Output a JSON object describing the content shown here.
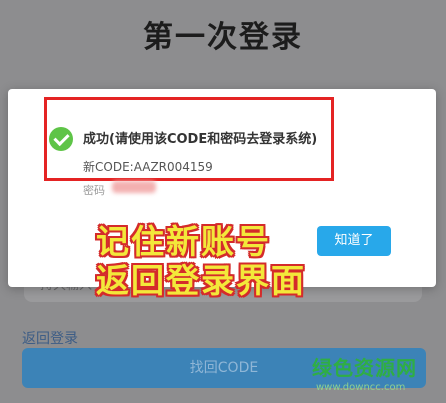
{
  "page": {
    "title": "第一次登录",
    "back_link": "返回登录",
    "find_code_button": "找回CODE",
    "bottom_input_hint": "持久输入"
  },
  "dialog": {
    "success_message": "成功(请使用该CODE和密码去登录系统)",
    "code_line": "新CODE:AAZR004159",
    "password_prefix": "密码",
    "confirm_button": "知道了"
  },
  "annotations": {
    "line1": "记住新账号",
    "line2": "返回登录界面"
  },
  "watermark": {
    "brand": "绿色资源网",
    "url": "www.downcc.com"
  },
  "colors": {
    "accent_blue": "#28a8ea",
    "success_green": "#5ec447",
    "highlight_red": "#e42323",
    "annotation_yellow": "#f3e83a"
  }
}
